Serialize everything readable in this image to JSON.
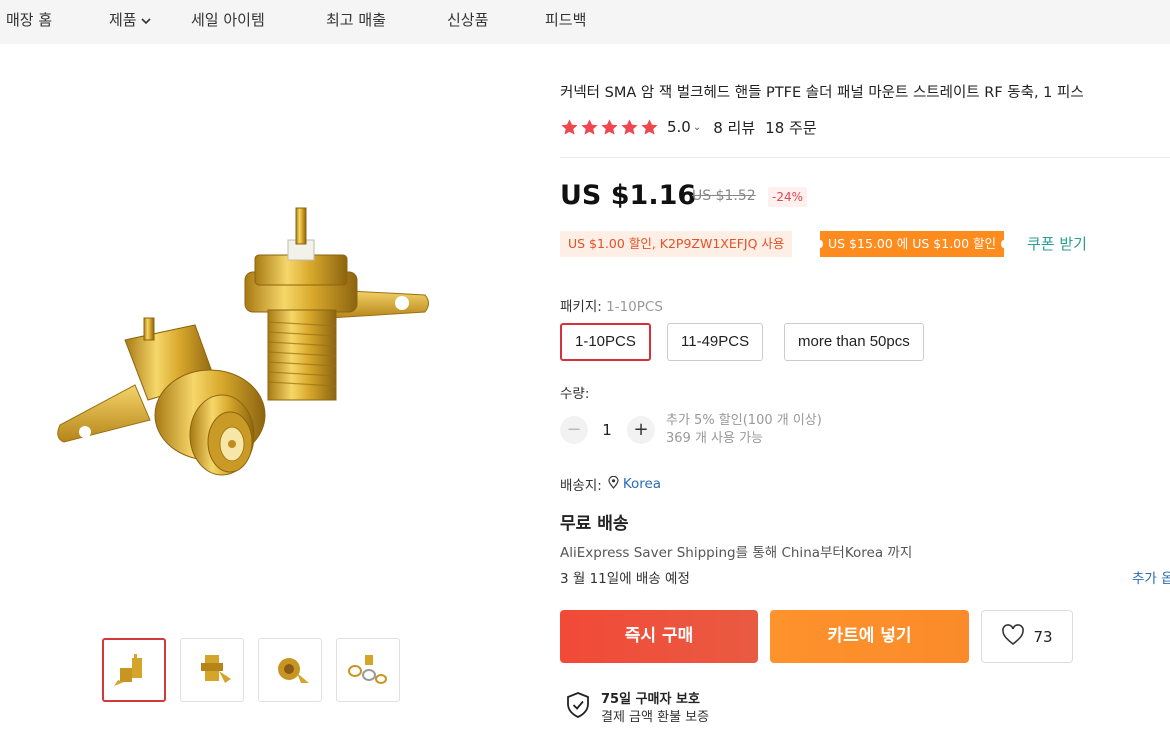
{
  "nav": {
    "items": [
      "매장 홈",
      "제품",
      "세일 아이템",
      "최고 매출",
      "신상품",
      "피드백"
    ]
  },
  "product": {
    "title": "커넥터 SMA 암 잭 벌크헤드 핸들 PTFE 솔더 패널 마운트 스트레이트 RF 동축, 1 피스",
    "rating": "5.0",
    "stars": 5,
    "reviews": "8 리뷰",
    "orders": "18 주문",
    "price": "US $1.16",
    "old_price": "US $1.52",
    "discount": "-24%"
  },
  "coupons": {
    "store_coupon": "US $1.00 할인, K2P9ZW1XEFJQ 사용",
    "threshold_coupon": "US $15.00 에 US $1.00 할인",
    "get_coupon": "쿠폰 받기"
  },
  "package": {
    "label": "패키지: ",
    "selected": "1-10PCS",
    "options": [
      "1-10PCS",
      "11-49PCS",
      "more than 50pcs"
    ]
  },
  "quantity": {
    "label": "수량:",
    "value": "1",
    "minus": "−",
    "plus": "+",
    "note1": "추가 5% 할인(100 개 이상)",
    "note2": "369 개 사용 가능"
  },
  "shipping": {
    "to_label": "배송지:",
    "country": "Korea",
    "free": "무료 배송",
    "method": "AliExpress Saver Shipping를 통해 China부터Korea 까지",
    "delivery": "3 월 11일에 배송 예정",
    "more": "추가 옵"
  },
  "actions": {
    "buy_now": "즉시 구매",
    "add_cart": "카트에 넣기",
    "wishlist_count": "73"
  },
  "protection": {
    "title": "75일 구매자 보호",
    "subtitle": "결제 금액 환불 보증"
  },
  "colors": {
    "accent_red": "#f14a37",
    "accent_orange": "#fe922c",
    "link_teal": "#2a9e94",
    "link_blue": "#2b6bb8",
    "star": "#f0464f"
  },
  "icons": [
    "chevron-down-icon",
    "star-icon",
    "location-pin-icon",
    "heart-icon",
    "shield-check-icon"
  ]
}
